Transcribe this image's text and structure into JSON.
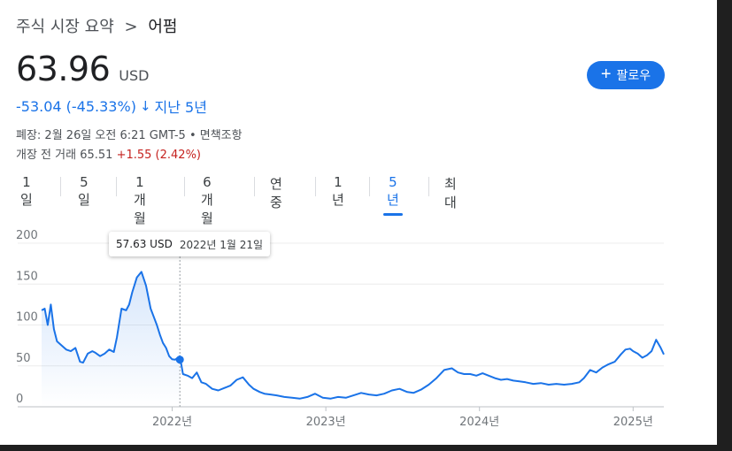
{
  "breadcrumb": {
    "parent": "주식 시장 요약",
    "sep": ">",
    "current": "어펌"
  },
  "quote": {
    "price": "63.96",
    "currency": "USD"
  },
  "follow_button": {
    "label": "팔로우",
    "icon": "plus-icon"
  },
  "change": {
    "text": "-53.04 (-45.33%)",
    "arrow": "arrow-down-icon",
    "period": "지난 5년"
  },
  "meta": {
    "closed": "폐장: 2월 26일 오전 6:21 GMT-5 • 면책조항",
    "premarket_label": "개장 전 거래",
    "premarket_price": "65.51",
    "premarket_change": "+1.55 (2.42%)"
  },
  "tabs": [
    {
      "label": "1일"
    },
    {
      "label": "5일"
    },
    {
      "label": "1개월"
    },
    {
      "label": "6개월"
    },
    {
      "label": "연중"
    },
    {
      "label": "1년"
    },
    {
      "label": "5년",
      "active": true
    },
    {
      "label": "최대"
    }
  ],
  "tooltip": {
    "price": "57.63 USD",
    "date": "2022년 1월 21일"
  },
  "colors": {
    "line": "#1a73e8",
    "accent": "#1a73e8",
    "negative": "#1a73e8",
    "premarket_up": "#c5221f"
  },
  "chart_data": {
    "type": "area",
    "title": "",
    "xlabel": "",
    "ylabel": "",
    "ylim": [
      0,
      200
    ],
    "yticks": [
      0,
      50,
      100,
      150,
      200
    ],
    "xticks": [
      "2022년",
      "2023년",
      "2024년",
      "2025년"
    ],
    "xlim": [
      2021.15,
      2025.2
    ],
    "grid": true,
    "highlight": {
      "x": 2022.05,
      "y": 57.63
    },
    "series": [
      {
        "x": [
          2021.15,
          2021.17,
          2021.19,
          2021.21,
          2021.23,
          2021.25,
          2021.28,
          2021.31,
          2021.34,
          2021.37,
          2021.4,
          2021.42,
          2021.45,
          2021.48,
          2021.5,
          2021.53,
          2021.56,
          2021.59,
          2021.62,
          2021.64,
          2021.67,
          2021.7,
          2021.72,
          2021.74,
          2021.77,
          2021.8,
          2021.83,
          2021.86,
          2021.88,
          2021.9,
          2021.92,
          2021.94,
          2021.96,
          2021.98,
          2022.0,
          2022.02,
          2022.05,
          2022.07,
          2022.1,
          2022.13,
          2022.16,
          2022.19,
          2022.22,
          2022.26,
          2022.3,
          2022.34,
          2022.38,
          2022.42,
          2022.46,
          2022.5,
          2022.53,
          2022.57,
          2022.6,
          2022.64,
          2022.68,
          2022.73,
          2022.78,
          2022.83,
          2022.88,
          2022.93,
          2022.98,
          2023.03,
          2023.08,
          2023.13,
          2023.18,
          2023.23,
          2023.28,
          2023.33,
          2023.38,
          2023.43,
          2023.48,
          2023.53,
          2023.57,
          2023.62,
          2023.67,
          2023.72,
          2023.77,
          2023.82,
          2023.86,
          2023.9,
          2023.94,
          2023.98,
          2024.02,
          2024.06,
          2024.1,
          2024.14,
          2024.18,
          2024.22,
          2024.26,
          2024.3,
          2024.35,
          2024.4,
          2024.45,
          2024.5,
          2024.55,
          2024.6,
          2024.65,
          2024.68,
          2024.72,
          2024.76,
          2024.8,
          2024.84,
          2024.88,
          2024.92,
          2024.95,
          2024.98,
          2025.0,
          2025.03,
          2025.06,
          2025.09,
          2025.12,
          2025.15,
          2025.18,
          2025.2
        ],
        "values": [
          118,
          120,
          100,
          125,
          95,
          80,
          75,
          70,
          68,
          72,
          55,
          54,
          65,
          68,
          66,
          62,
          65,
          70,
          67,
          85,
          120,
          118,
          125,
          140,
          158,
          165,
          148,
          120,
          110,
          100,
          88,
          78,
          72,
          62,
          58,
          57.63,
          62,
          40,
          38,
          35,
          42,
          30,
          28,
          22,
          20,
          23,
          26,
          33,
          36,
          27,
          22,
          18,
          16,
          15,
          14,
          12,
          11,
          10,
          12,
          16,
          11,
          10,
          12,
          11,
          14,
          17,
          15,
          14,
          16,
          20,
          22,
          18,
          17,
          21,
          27,
          35,
          45,
          47,
          42,
          40,
          40,
          38,
          41,
          38,
          35,
          33,
          34,
          32,
          31,
          30,
          28,
          29,
          27,
          28,
          27,
          28,
          30,
          35,
          45,
          42,
          48,
          52,
          55,
          64,
          70,
          71,
          68,
          65,
          60,
          63,
          68,
          82,
          72,
          63.96
        ]
      }
    ]
  }
}
